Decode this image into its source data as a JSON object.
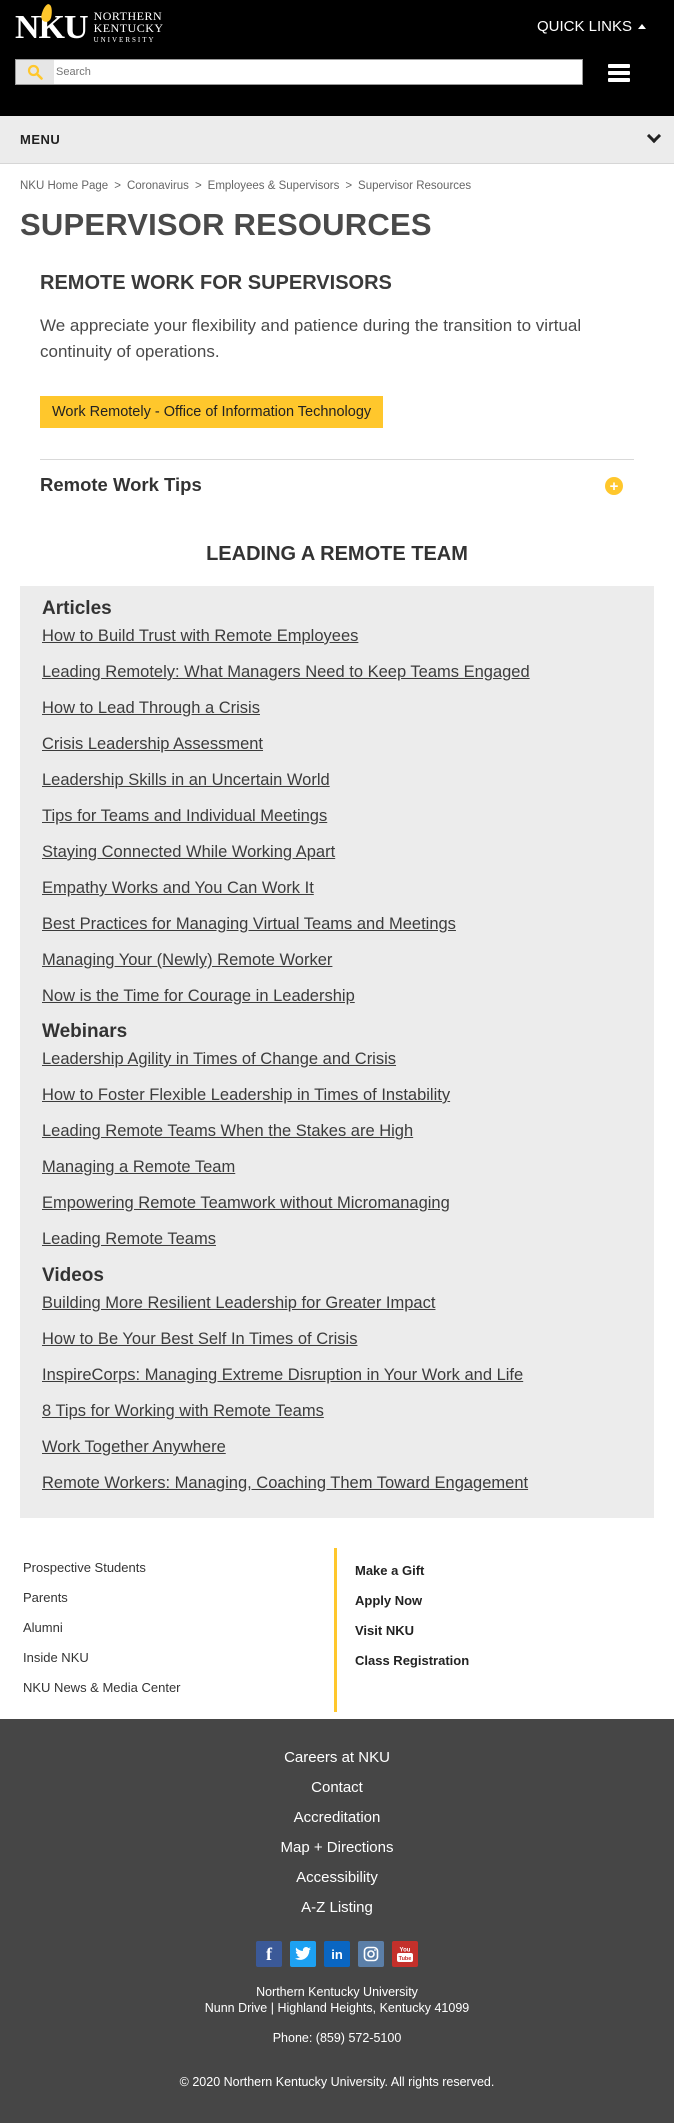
{
  "header": {
    "logo_mark": "NKU",
    "logo_line1": "NORTHERN",
    "logo_line2": "KENTUCKY",
    "logo_line3": "UNIVERSITY",
    "quick_links": "QUICK LINKS",
    "search_placeholder": "Search"
  },
  "menu": {
    "label": "MENU"
  },
  "breadcrumb": [
    "NKU Home Page",
    "Coronavirus",
    "Employees & Supervisors",
    "Supervisor Resources"
  ],
  "page_title": "SUPERVISOR RESOURCES",
  "remote_work": {
    "title": "REMOTE WORK FOR SUPERVISORS",
    "intro": "We appreciate your flexibility and patience during the transition to virtual continuity of operations.",
    "button": "Work Remotely - Office of Information Technology",
    "accordion_title": "Remote Work Tips"
  },
  "leading": {
    "title": "LEADING A REMOTE TEAM",
    "articles_title": "Articles",
    "articles": [
      "How to Build Trust with Remote Employees",
      "Leading Remotely: What Managers Need to Keep Teams Engaged",
      "How to Lead Through a Crisis",
      "Crisis Leadership Assessment",
      "Leadership Skills in an Uncertain World",
      "Tips for Teams and Individual Meetings",
      "Staying Connected While Working Apart",
      "Empathy Works and You Can Work It",
      "Best Practices for Managing Virtual Teams and Meetings",
      "Managing Your (Newly) Remote Worker",
      "Now is the Time for Courage in Leadership"
    ],
    "webinars_title": "Webinars",
    "webinars": [
      "Leadership Agility in Times of Change and Crisis",
      "How to Foster Flexible Leadership in Times of Instability",
      "Leading Remote Teams When the Stakes are High",
      "Managing a Remote Team",
      "Empowering Remote Teamwork without Micromanaging",
      "Leading Remote Teams"
    ],
    "videos_title": "Videos",
    "videos": [
      "Building More Resilient Leadership for Greater Impact",
      "How to Be Your Best Self In Times of Crisis",
      "InspireCorps: Managing Extreme Disruption in Your Work and Life",
      "8 Tips for Working with Remote Teams",
      "Work Together Anywhere",
      "Remote Workers: Managing, Coaching Them Toward Engagement"
    ]
  },
  "footer_links_left": [
    "Prospective Students",
    "Parents",
    "Alumni",
    "Inside NKU",
    "NKU News & Media Center"
  ],
  "footer_links_right": [
    "Make a Gift",
    "Apply Now",
    "Visit NKU",
    "Class Registration"
  ],
  "dark_footer": {
    "links": [
      "Careers at NKU",
      "Contact",
      "Accreditation",
      "Map + Directions",
      "Accessibility",
      "A-Z Listing"
    ],
    "social": [
      "facebook-icon",
      "twitter-icon",
      "linkedin-icon",
      "instagram-icon",
      "youtube-icon"
    ],
    "org_name": "Northern Kentucky University",
    "address": "Nunn Drive | Highland Heights, Kentucky 41099",
    "phone": "Phone: (859) 572-5100",
    "copyright": "© 2020 Northern Kentucky University. All rights reserved."
  },
  "colors": {
    "accent": "#ffc72c",
    "header_bg": "#000000",
    "footer_bg": "#464646",
    "panel_bg": "#ececec"
  }
}
